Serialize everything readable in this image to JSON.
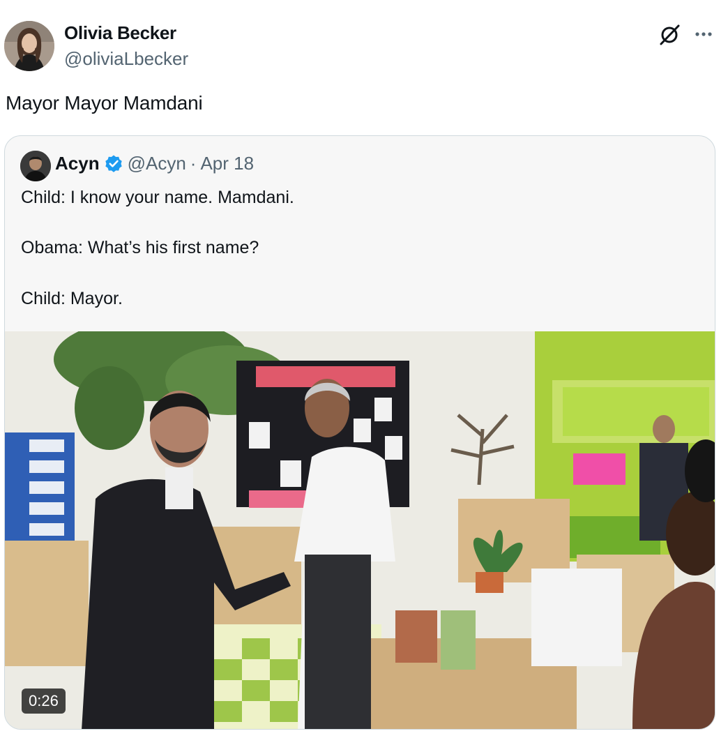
{
  "tweet": {
    "author_name": "Olivia Becker",
    "author_handle": "@oliviaLbecker",
    "text": "Mayor Mayor Mamdani"
  },
  "icons": {
    "grok": "grok-icon",
    "more": "more-icon",
    "verified": "verified-badge-icon"
  },
  "quote": {
    "author_name": "Acyn",
    "author_handle": "@Acyn",
    "separator": "·",
    "date": "Apr 18",
    "lines": [
      "Child: I know your name. Mamdani.",
      "Obama: What’s his first name?",
      "Child: Mayor."
    ],
    "video": {
      "duration": "0:26"
    }
  },
  "colors": {
    "text_primary": "#0f1419",
    "text_secondary": "#536471",
    "verified_blue": "#1d9bf0",
    "card_border": "#cfd9de"
  }
}
